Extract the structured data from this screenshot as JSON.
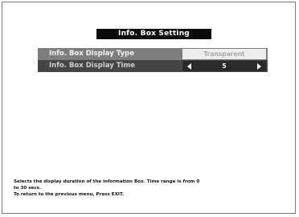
{
  "title": "Info. Box Setting",
  "menu": {
    "items": [
      {
        "label": "Info. Box Display Type",
        "value": "Transparent"
      },
      {
        "label": "Info. Box Display Time",
        "value": "5"
      }
    ]
  },
  "help": {
    "line1": "Selects the display duration of the information Box.  Time range is from 0",
    "line2": "to 30 secs.",
    "line3": "To return to the previous menu, Press EXIT."
  },
  "colors": {
    "title_bg": "#0b0b0b",
    "selected_row": "#7e7e7e",
    "unselected_row": "#454545",
    "value_box_light": "#ededed",
    "value_box_dark": "#2a2a2a"
  },
  "icons": [
    "arrow-left-icon",
    "arrow-right-icon"
  ]
}
